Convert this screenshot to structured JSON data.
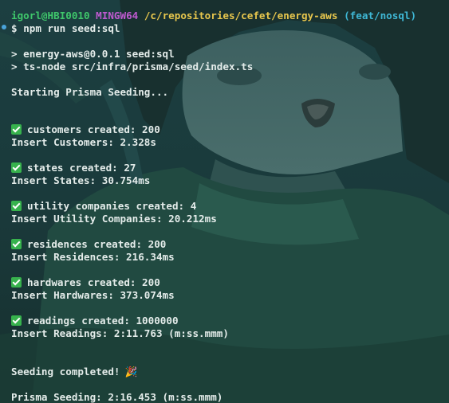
{
  "prompt": {
    "user_host": "igorl@HBI0010",
    "env": "MINGW64",
    "path": "/c/repositories/cefet/energy-aws",
    "branch": "(feat/nosql)",
    "symbol": "$",
    "command": "npm run seed:sql"
  },
  "script": {
    "line1": "> energy-aws@0.0.1 seed:sql",
    "line2": "> ts-node src/infra/prisma/seed/index.ts"
  },
  "starting": "Starting Prisma Seeding...",
  "steps": [
    {
      "created": "customers created: 200",
      "insert": "Insert Customers: 2.328s"
    },
    {
      "created": "states created: 27",
      "insert": "Insert States: 30.754ms"
    },
    {
      "created": "utility companies created: 4",
      "insert": "Insert Utility Companies: 20.212ms"
    },
    {
      "created": "residences created: 200",
      "insert": "Insert Residences: 216.34ms"
    },
    {
      "created": "hardwares created: 200",
      "insert": "Insert Hardwares: 373.074ms"
    },
    {
      "created": "readings created: 1000000",
      "insert": "Insert Readings: 2:11.763 (m:ss.mmm)"
    }
  ],
  "completed": "Seeding completed!",
  "completed_icon": "party-popper-icon",
  "total": "Prisma Seeding: 2:16.453 (m:ss.mmm)",
  "icons": {
    "check": "check-mark-button-icon",
    "prompt_marker": "command-marker-icon"
  },
  "colors": {
    "user_host": "#3fc76b",
    "env": "#c15ad1",
    "path": "#e7c64d",
    "branch": "#3fb8d6",
    "check": "#37b24d"
  }
}
